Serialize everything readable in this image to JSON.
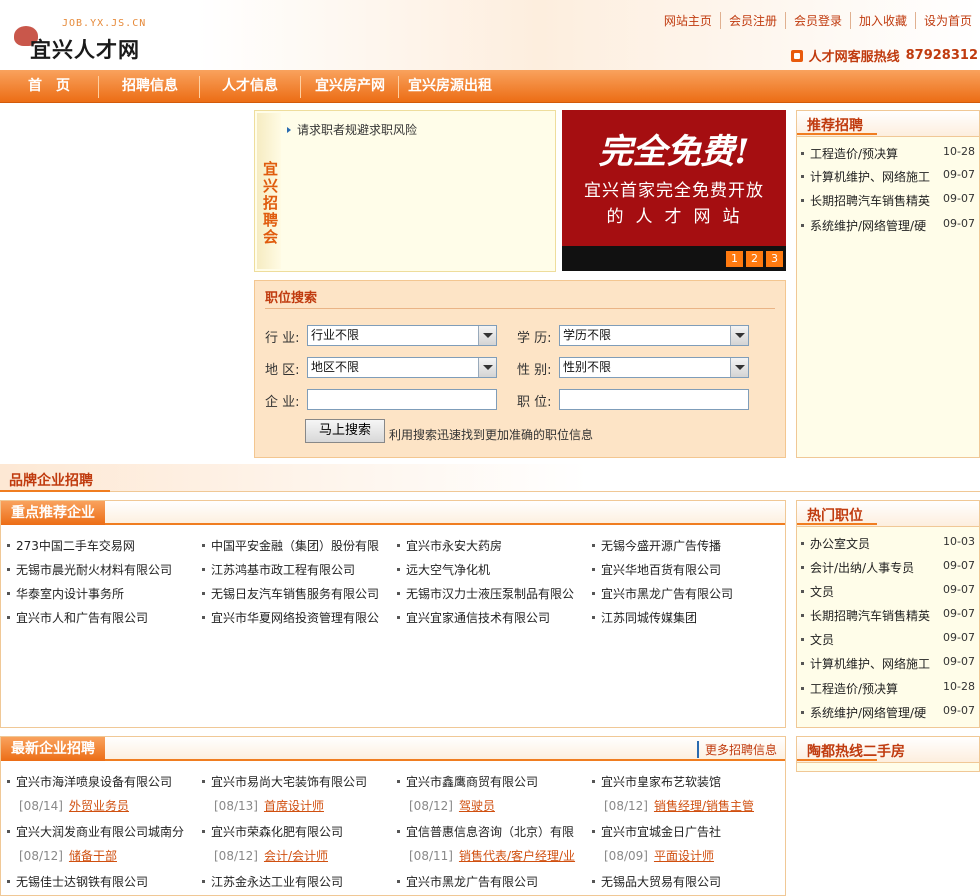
{
  "header": {
    "logo_url_text": "JOB.YX.JS.CN",
    "logo_name": "宜兴人才网",
    "top_links": [
      "网站主页",
      "会员注册",
      "会员登录",
      "加入收藏",
      "设为首页"
    ],
    "hotline_label": "人才网客服热线",
    "hotline_number": "87928312"
  },
  "nav": [
    "首　页",
    "招聘信息",
    "人才信息",
    "宜兴房产网",
    "宜兴房源出租"
  ],
  "job_fair": {
    "side_title": "宜兴招聘会",
    "notice": "请求职者规避求职风险"
  },
  "banner": {
    "headline": "完全免费!",
    "line1": "宜兴首家完全免费开放",
    "line2": "的人才网站",
    "pages": [
      "1",
      "2",
      "3"
    ]
  },
  "search": {
    "title": "职位搜索",
    "industry_label": "行 业:",
    "industry_value": "行业不限",
    "education_label": "学 历:",
    "education_value": "学历不限",
    "area_label": "地 区:",
    "area_value": "地区不限",
    "gender_label": "性 别:",
    "gender_value": "性别不限",
    "company_label": "企 业:",
    "position_label": "职 位:",
    "button": "马上搜索",
    "tip": "利用搜索迅速找到更加准确的职位信息"
  },
  "recommended": {
    "title": "推荐招聘",
    "items": [
      {
        "name": "工程造价/预决算",
        "date": "10-28"
      },
      {
        "name": "计算机维护、网络施工",
        "date": "09-07"
      },
      {
        "name": "长期招聘汽车销售精英",
        "date": "09-07"
      },
      {
        "name": "系统维护/网络管理/硬",
        "date": "09-07"
      }
    ]
  },
  "brand_section": {
    "title": "品牌企业招聘"
  },
  "key_companies": {
    "title": "重点推荐企业",
    "rows": [
      [
        "273中国二手车交易网",
        "中国平安金融（集团）股份有限",
        "宜兴市永安大药房",
        "无锡今盛开源广告传播"
      ],
      [
        "无锡市晨光耐火材料有限公司",
        "江苏鸿基市政工程有限公司",
        "远大空气净化机",
        "宜兴华地百货有限公司"
      ],
      [
        "华泰室内设计事务所",
        "无锡日友汽车销售服务有限公司",
        "无锡市汉力士液压泵制品有限公",
        "宜兴市黑龙广告有限公司"
      ],
      [
        "宜兴市人和广告有限公司",
        "宜兴市华夏网络投资管理有限公",
        "宜兴宜家通信技术有限公司",
        "江苏同城传媒集团"
      ]
    ]
  },
  "hot_jobs": {
    "title": "热门职位",
    "items": [
      {
        "name": "办公室文员",
        "date": "10-03"
      },
      {
        "name": "会计/出纳/人事专员",
        "date": "09-07"
      },
      {
        "name": "文员",
        "date": "09-07"
      },
      {
        "name": "长期招聘汽车销售精英",
        "date": "09-07"
      },
      {
        "name": "文员",
        "date": "09-07"
      },
      {
        "name": "计算机维护、网络施工",
        "date": "09-07"
      },
      {
        "name": "工程造价/预决算",
        "date": "10-28"
      },
      {
        "name": "系统维护/网络管理/硬",
        "date": "09-07"
      }
    ]
  },
  "latest": {
    "title": "最新企业招聘",
    "more": "更多招聘信息",
    "entries": [
      {
        "company": "宜兴市海洋喷泉设备有限公司",
        "date": "[08/14]",
        "job": "外贸业务员"
      },
      {
        "company": "宜兴市易尚大宅装饰有限公司",
        "date": "[08/13]",
        "job": "首席设计师"
      },
      {
        "company": "宜兴市鑫鹰商贸有限公司",
        "date": "[08/12]",
        "job": "驾驶员"
      },
      {
        "company": "宜兴市皇家布艺软装馆",
        "date": "[08/12]",
        "job": "销售经理/销售主管"
      },
      {
        "company": "宜兴大润发商业有限公司城南分",
        "date": "[08/12]",
        "job": "储备干部"
      },
      {
        "company": "宜兴市荣森化肥有限公司",
        "date": "[08/12]",
        "job": "会计/会计师"
      },
      {
        "company": "宜信普惠信息咨询（北京）有限",
        "date": "[08/11]",
        "job": "销售代表/客户经理/业"
      },
      {
        "company": "宜兴市宜城金日广告社",
        "date": "[08/09]",
        "job": "平面设计师"
      },
      {
        "company": "无锡佳士达钢铁有限公司",
        "date": "",
        "job": ""
      },
      {
        "company": "江苏金永达工业有限公司",
        "date": "",
        "job": ""
      },
      {
        "company": "宜兴市黑龙广告有限公司",
        "date": "",
        "job": ""
      },
      {
        "company": "无锡品大贸易有限公司",
        "date": "",
        "job": ""
      }
    ]
  },
  "secondhand": {
    "title": "陶都热线二手房"
  }
}
